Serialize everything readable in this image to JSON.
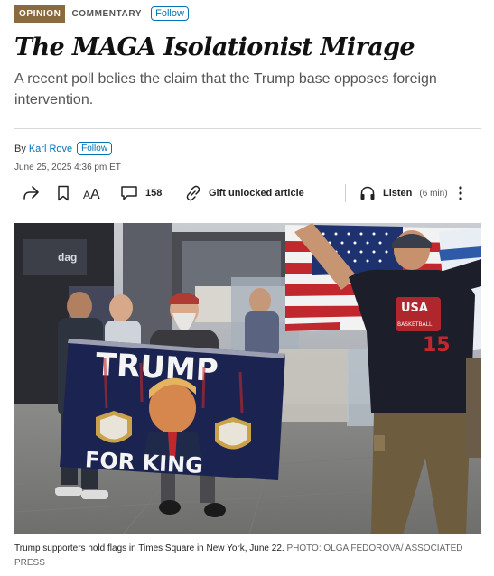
{
  "header": {
    "section_badge": "OPINION",
    "section_name": "COMMENTARY",
    "follow_label": "Follow"
  },
  "article": {
    "headline": "The MAGA Isolationist Mirage",
    "dek": "A recent poll belies the claim that the Trump base opposes foreign intervention.",
    "byline_prefix": "By",
    "author": "Karl Rove",
    "author_follow_label": "Follow",
    "date": "June 25, 2025 4:36 pm ET"
  },
  "toolbar": {
    "comment_count": "158",
    "gift_label": "Gift unlocked article",
    "listen_label": "Listen",
    "listen_duration": "(6 min)"
  },
  "photo": {
    "banner_top": "TRUMP",
    "banner_bottom": "FOR KING",
    "shirt_text_1": "USA",
    "shirt_text_2": "BASKETBALL",
    "shirt_number": "15",
    "caption": "Trump supporters hold flags in Times Square in New York, June 22.",
    "credit": "PHOTO: OLGA FEDOROVA/ ASSOCIATED PRESS"
  },
  "colors": {
    "opinion_badge": "#8c6a3f",
    "link_blue": "#0274b6",
    "banner_navy": "#1b2450",
    "flag_red": "#c0282d"
  }
}
